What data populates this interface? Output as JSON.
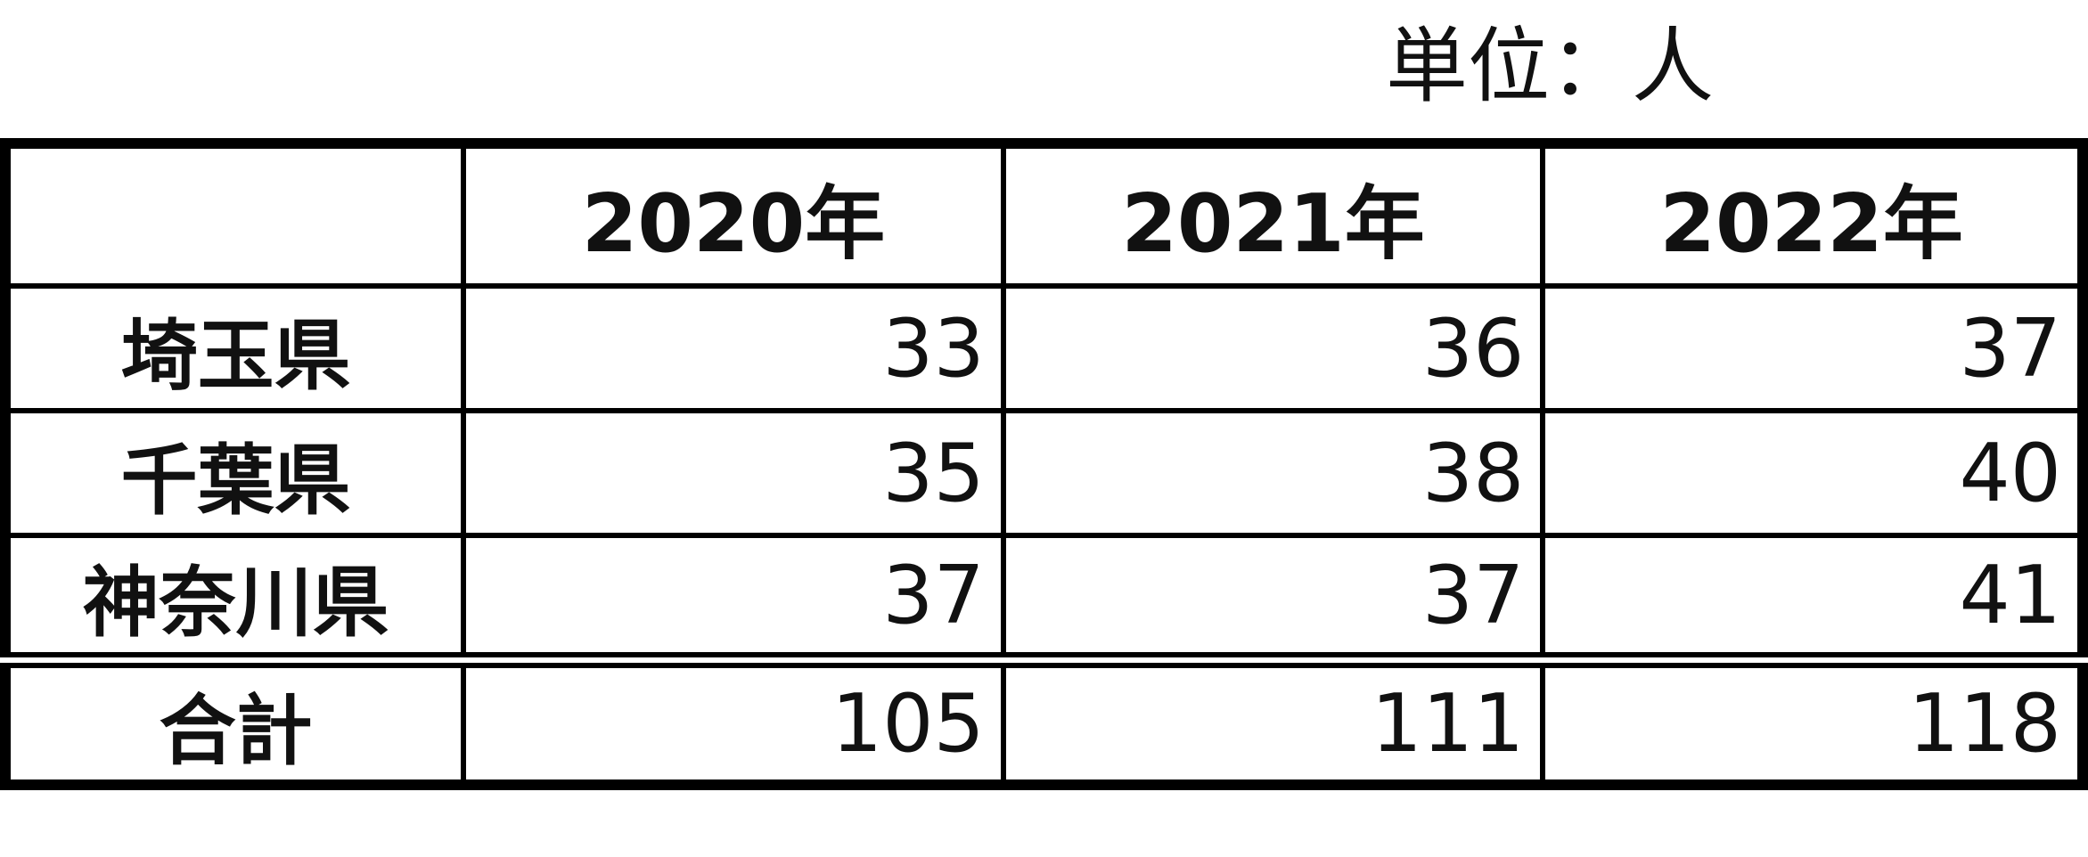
{
  "unit_label": "単位：人",
  "table": {
    "columns": [
      "",
      "2020年",
      "2021年",
      "2022年"
    ],
    "rows": [
      {
        "label": "埼玉県",
        "values": [
          "33",
          "36",
          "37"
        ]
      },
      {
        "label": "千葉県",
        "values": [
          "35",
          "38",
          "40"
        ]
      },
      {
        "label": "神奈川県",
        "values": [
          "37",
          "37",
          "41"
        ]
      }
    ],
    "total": {
      "label": "合計",
      "values": [
        "105",
        "111",
        "118"
      ]
    }
  }
}
